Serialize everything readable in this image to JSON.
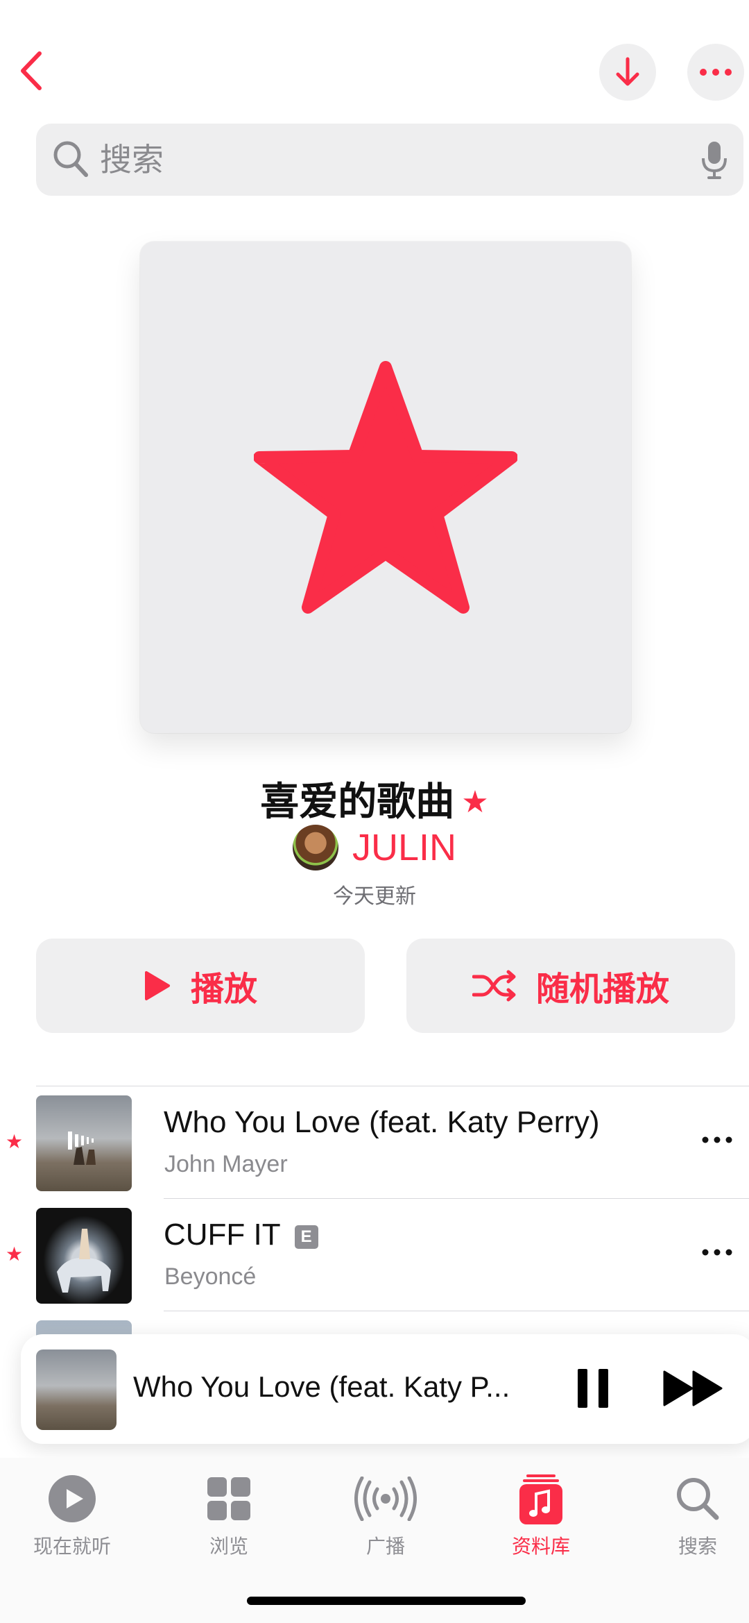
{
  "header": {
    "back_icon": "chevron-left-icon",
    "download_icon": "arrow-down-icon",
    "more_icon": "ellipsis-icon"
  },
  "search": {
    "placeholder": "搜索",
    "search_icon": "search-icon",
    "mic_icon": "microphone-icon"
  },
  "playlist": {
    "artwork_icon": "star-icon",
    "title": "喜爱的歌曲",
    "title_badge": "★",
    "curator": "JULIN",
    "updated": "今天更新"
  },
  "actions": {
    "play_label": "播放",
    "shuffle_label": "随机播放"
  },
  "songs": [
    {
      "favorite": "★",
      "title": "Who You Love (feat. Katy Perry)",
      "artist": "John Mayer",
      "explicit": false
    },
    {
      "favorite": "★",
      "title": "CUFF IT",
      "artist": "Beyoncé",
      "explicit": true,
      "explicit_label": "E"
    }
  ],
  "mini_player": {
    "title": "Who You Love (feat. Katy P...",
    "pause_icon": "pause-icon",
    "forward_icon": "fast-forward-icon"
  },
  "tabs": [
    {
      "label": "现在就听",
      "icon": "play-circle-icon",
      "active": false
    },
    {
      "label": "浏览",
      "icon": "grid-icon",
      "active": false
    },
    {
      "label": "广播",
      "icon": "broadcast-icon",
      "active": false
    },
    {
      "label": "资料库",
      "icon": "music-library-icon",
      "active": true
    },
    {
      "label": "搜索",
      "icon": "search-icon",
      "active": false
    }
  ],
  "colors": {
    "accent": "#fa2d48",
    "secondary_text": "#8a8a8e",
    "button_bg": "#efeff0"
  }
}
